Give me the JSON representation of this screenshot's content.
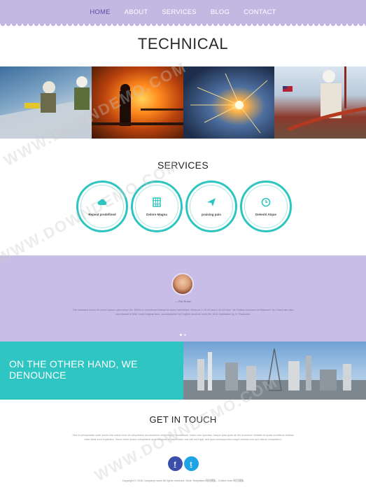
{
  "nav": {
    "items": [
      {
        "label": "HOME",
        "active": true
      },
      {
        "label": "ABOUT",
        "active": false
      },
      {
        "label": "SERVICES",
        "active": false
      },
      {
        "label": "BLOG",
        "active": false
      },
      {
        "label": "CONTACT",
        "active": false
      }
    ]
  },
  "page": {
    "title": "TECHNICAL"
  },
  "services": {
    "title": "SERVICES",
    "items": [
      {
        "label": "Repeat predefined",
        "icon": "cloud-icon"
      },
      {
        "label": "Dolore Magna",
        "icon": "film-icon"
      },
      {
        "label": "praising pain",
        "icon": "send-icon"
      },
      {
        "label": "Deleniti Atque",
        "icon": "clock-icon"
      }
    ]
  },
  "testimonial": {
    "author": "— Rai Rosie",
    "text": "The standard chunk of Lorem Ipsum used since the 1500s is reproduced below for those interested. Sections 1.10.32 and 1.10.33 from \"de Finibus Bonorum et Malorum\" by Cicero are also reproduced in their exact original form, accompanied by English versions from the 1914 translation by H. Rackham."
  },
  "promo": {
    "heading": "ON THE OTHER HAND, WE DENOUNCE"
  },
  "contact": {
    "title": "GET IN TOUCH",
    "text": "Sed ut perspiciatis unde omnis iste natus error sit voluptatem accusantium doloremque laudantium, totam rem aperiam, eaque ipsa quae ab illo inventore veritatis et quasi architecto beatae vitae dicta sunt explicabo. Nemo enim ipsam voluptatem quia voluptas sit aspernatur aut odit aut fugit, sed quia consequuntur magni dolores eos qui ratione voluptatem.",
    "social": [
      {
        "label": "f",
        "name": "facebook-icon",
        "color": "#3b4fa8"
      },
      {
        "label": "t",
        "name": "twitter-icon",
        "color": "#1ea3e4"
      }
    ],
    "copyright": "Copyright © 2016 Company name All rights reserved. More Templates 网站模板 - Collect from 网页模板"
  },
  "watermark": {
    "text": "WWW.DOWNDEMO.COM"
  },
  "colors": {
    "nav_bg": "#c2b8e2",
    "accent_teal": "#2ec5c0",
    "testimonial_bg": "#c7bde6",
    "facebook": "#3b4fa8",
    "twitter": "#1ea3e4"
  }
}
